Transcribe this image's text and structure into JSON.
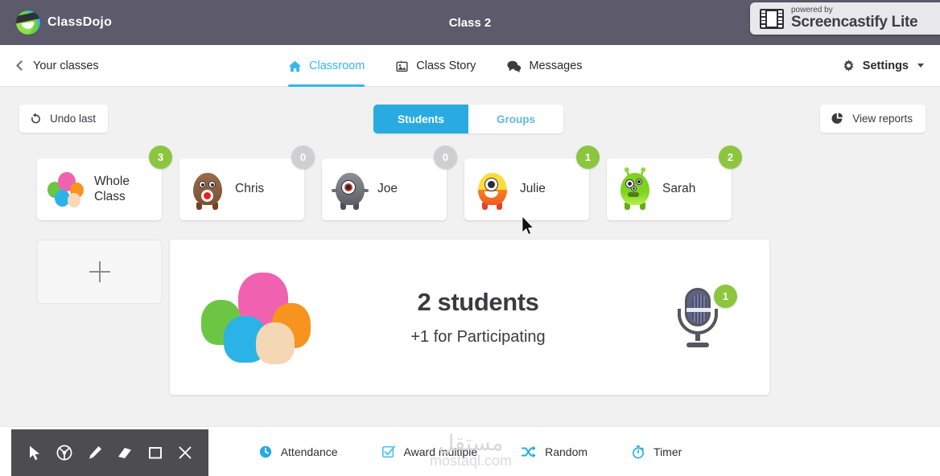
{
  "window": {
    "header_title": "Class 2",
    "brand": "ClassDojo",
    "watermark": {
      "powered_by": "powered by",
      "product": "Screencastify Lite"
    }
  },
  "nav": {
    "back_label": "Your classes",
    "tabs": [
      {
        "label": "Classroom",
        "icon": "home-icon",
        "active": true
      },
      {
        "label": "Class Story",
        "icon": "photo-icon",
        "active": false
      },
      {
        "label": "Messages",
        "icon": "chat-icon",
        "active": false
      }
    ],
    "settings_label": "Settings"
  },
  "toolbar": {
    "undo_label": "Undo last",
    "reports_label": "View reports",
    "toggle": {
      "students_label": "Students",
      "groups_label": "Groups",
      "selected": "Students"
    }
  },
  "students": [
    {
      "name": "Whole Class",
      "points": "3",
      "positive": true,
      "avatar": "whole-class-cluster"
    },
    {
      "name": "Chris",
      "points": "0",
      "positive": false,
      "avatar": "brown-monster"
    },
    {
      "name": "Joe",
      "points": "0",
      "positive": false,
      "avatar": "gray-monster"
    },
    {
      "name": "Julie",
      "points": "1",
      "positive": true,
      "avatar": "yellow-monster"
    },
    {
      "name": "Sarah",
      "points": "2",
      "positive": true,
      "avatar": "green-monster"
    }
  ],
  "add_student": {
    "icon": "plus-icon"
  },
  "award": {
    "count_label": "2 students",
    "reason_label": "+1 for Participating",
    "skill_icon": "microphone-icon",
    "skill_badge": "1"
  },
  "bottom_bar": [
    {
      "label": "Attendance",
      "icon": "clock-icon"
    },
    {
      "label": "Award multiple",
      "icon": "checkbox-icon"
    },
    {
      "label": "Random",
      "icon": "shuffle-icon"
    },
    {
      "label": "Timer",
      "icon": "stopwatch-icon"
    }
  ],
  "mostaql_watermark": {
    "arabic": "مستقل",
    "latin": "mostaql.com"
  },
  "annotation_tools": [
    {
      "icon": "cursor-icon"
    },
    {
      "icon": "spotlight-icon"
    },
    {
      "icon": "pen-icon"
    },
    {
      "icon": "eraser-icon"
    },
    {
      "icon": "rectangle-icon"
    },
    {
      "icon": "close-icon"
    }
  ],
  "colors": {
    "header": "#5c5a6b",
    "accent_blue": "#29ABE2",
    "badge_green": "#8cc63e",
    "badge_gray": "#cfcfd2",
    "background": "#f1f1f2"
  }
}
